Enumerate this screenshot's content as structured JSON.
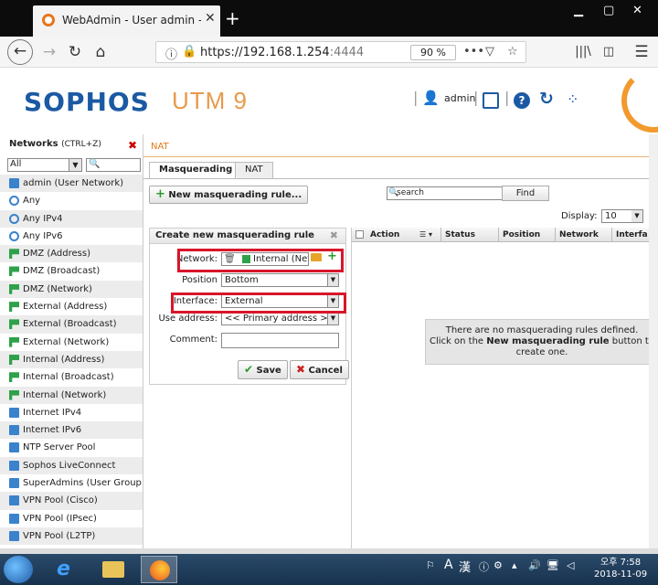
{
  "browser": {
    "tab_title": "WebAdmin - User admin - De",
    "url_main": "https://192.168.1.254",
    "url_port": ":4444",
    "zoom": "90 %"
  },
  "header": {
    "logo": "SOPHOS",
    "product": "UTM 9",
    "user": "admin"
  },
  "sidebar": {
    "title": "Networks",
    "shortcut": "(CTRL+Z)",
    "filter_value": "All",
    "items": [
      {
        "label": "admin (User Network)",
        "icon": "host"
      },
      {
        "label": "Any",
        "icon": "any"
      },
      {
        "label": "Any IPv4",
        "icon": "any"
      },
      {
        "label": "Any IPv6",
        "icon": "any"
      },
      {
        "label": "DMZ (Address)",
        "icon": "net"
      },
      {
        "label": "DMZ (Broadcast)",
        "icon": "net"
      },
      {
        "label": "DMZ (Network)",
        "icon": "net"
      },
      {
        "label": "External (Address)",
        "icon": "net"
      },
      {
        "label": "External (Broadcast)",
        "icon": "net"
      },
      {
        "label": "External (Network)",
        "icon": "net"
      },
      {
        "label": "Internal (Address)",
        "icon": "net"
      },
      {
        "label": "Internal (Broadcast)",
        "icon": "net"
      },
      {
        "label": "Internal (Network)",
        "icon": "net"
      },
      {
        "label": "Internet IPv4",
        "icon": "host"
      },
      {
        "label": "Internet IPv6",
        "icon": "host"
      },
      {
        "label": "NTP Server Pool",
        "icon": "host"
      },
      {
        "label": "Sophos LiveConnect",
        "icon": "host"
      },
      {
        "label": "SuperAdmins (User Group Ne",
        "icon": "host"
      },
      {
        "label": "VPN Pool (Cisco)",
        "icon": "host"
      },
      {
        "label": "VPN Pool (IPsec)",
        "icon": "host"
      },
      {
        "label": "VPN Pool (L2TP)",
        "icon": "host"
      }
    ]
  },
  "main": {
    "breadcrumb": "NAT",
    "tabs": [
      {
        "label": "Masquerading",
        "active": true
      },
      {
        "label": "NAT",
        "active": false
      }
    ],
    "new_button": "New masquerading rule...",
    "search_placeholder": "search",
    "find_button": "Find",
    "display_label": "Display:",
    "display_value": "10"
  },
  "form": {
    "title": "Create new masquerading rule",
    "network_label": "Network:",
    "network_value": "Internal (Network)",
    "position_label": "Position",
    "position_value": "Bottom",
    "interface_label": "Interface:",
    "interface_value": "External",
    "use_address_label": "Use address:",
    "use_address_value": "<< Primary address >>",
    "comment_label": "Comment:",
    "comment_value": "",
    "save_button": "Save",
    "cancel_button": "Cancel"
  },
  "grid": {
    "columns": [
      "Action",
      "Status",
      "Position",
      "Network",
      "Interfa"
    ],
    "empty_line1": "There are no masquerading rules defined.",
    "empty_line2_pre": "Click on the ",
    "empty_line2_bold": "New masquerading rule",
    "empty_line2_post": " button to",
    "empty_line3": "create one."
  },
  "taskbar": {
    "ime_char1": "A",
    "ime_char2": "漢",
    "time": "오후 7:58",
    "date": "2018-11-09"
  },
  "colors": {
    "sophos_blue": "#1b5aa3",
    "utm_orange": "#e89a4a",
    "highlight_red": "#d8162a"
  }
}
